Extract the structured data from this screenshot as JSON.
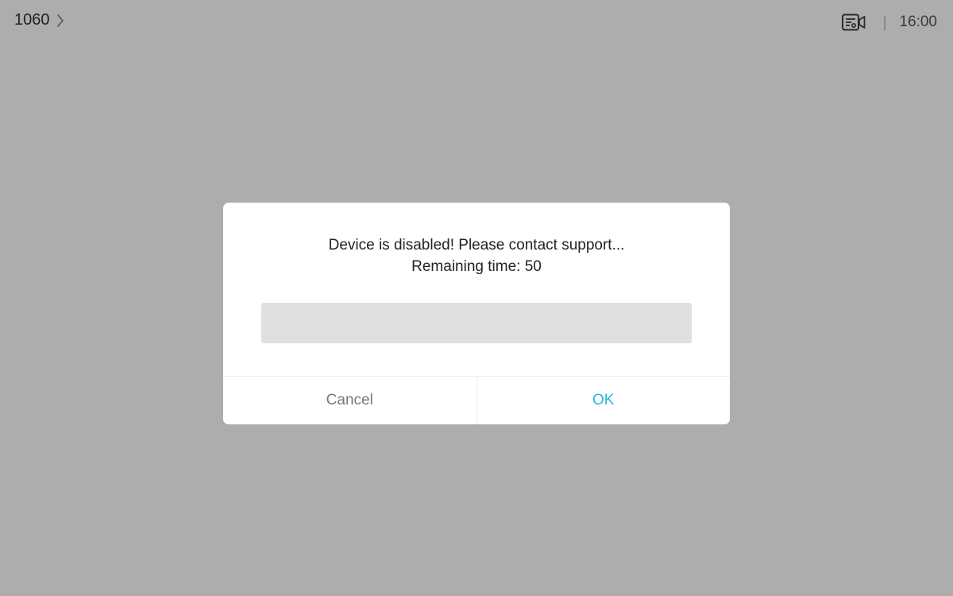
{
  "header": {
    "device_id": "1060",
    "time": "16:00",
    "separator": "|"
  },
  "icons": {
    "chevron": "chevron-right-icon",
    "camera": "video-camera-settings-icon"
  },
  "dialog": {
    "message": "Device is disabled! Please contact support...",
    "remaining": "Remaining time: 50",
    "progress": 0,
    "cancel_label": "Cancel",
    "ok_label": "OK"
  },
  "colors": {
    "background": "#adadad",
    "accent": "#27b8d6",
    "progress_track": "#e0e0e0"
  }
}
